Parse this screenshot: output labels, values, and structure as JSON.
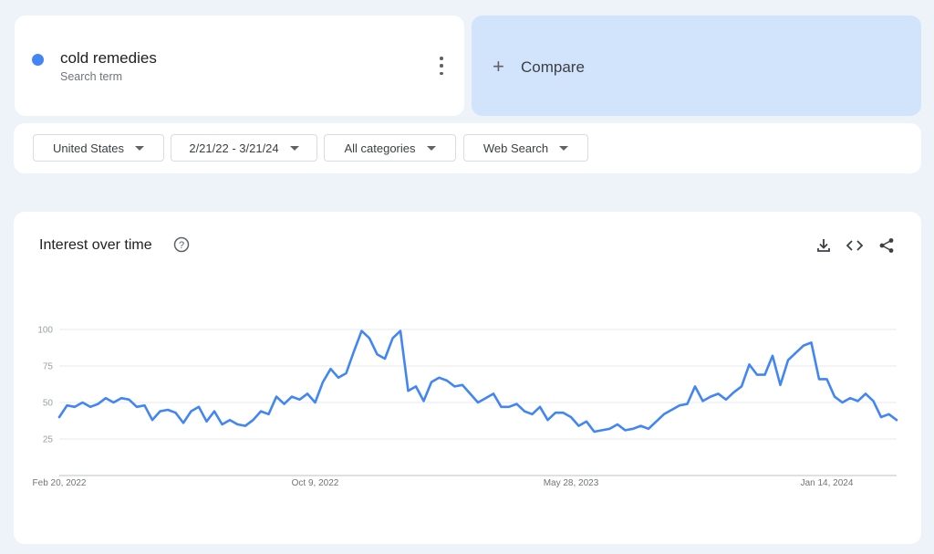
{
  "search_term": {
    "name": "cold remedies",
    "subtitle": "Search term",
    "color": "#4285f4"
  },
  "compare": {
    "label": "Compare"
  },
  "filters": {
    "region": "United States",
    "date_range": "2/21/22 - 3/21/24",
    "category": "All categories",
    "search_type": "Web Search"
  },
  "chart_section": {
    "title": "Interest over time"
  },
  "chart_data": {
    "type": "line",
    "title": "Interest over time",
    "y_ticks": [
      "25",
      "50",
      "75",
      "100"
    ],
    "x_labels": [
      "Feb 20, 2022",
      "Oct 9, 2022",
      "May 28, 2023",
      "Jan 14, 2024"
    ],
    "ylim": [
      0,
      100
    ],
    "grid": true,
    "series": [
      {
        "name": "cold remedies",
        "color": "#4285f4",
        "values": [
          40,
          48,
          47,
          50,
          47,
          49,
          53,
          50,
          53,
          52,
          47,
          48,
          38,
          44,
          45,
          43,
          36,
          44,
          47,
          37,
          44,
          35,
          38,
          35,
          34,
          38,
          44,
          42,
          54,
          49,
          54,
          52,
          56,
          50,
          64,
          73,
          67,
          70,
          85,
          99,
          94,
          83,
          80,
          94,
          99,
          58,
          61,
          51,
          64,
          67,
          65,
          61,
          62,
          56,
          50,
          53,
          56,
          47,
          47,
          49,
          44,
          42,
          47,
          38,
          43,
          43,
          40,
          34,
          37,
          30,
          31,
          32,
          35,
          31,
          32,
          34,
          32,
          37,
          42,
          45,
          48,
          49,
          61,
          51,
          54,
          56,
          52,
          57,
          61,
          76,
          69,
          69,
          82,
          62,
          79,
          84,
          89,
          91,
          66,
          66,
          54,
          50,
          53,
          51,
          56,
          51,
          40,
          42,
          38
        ]
      }
    ]
  }
}
